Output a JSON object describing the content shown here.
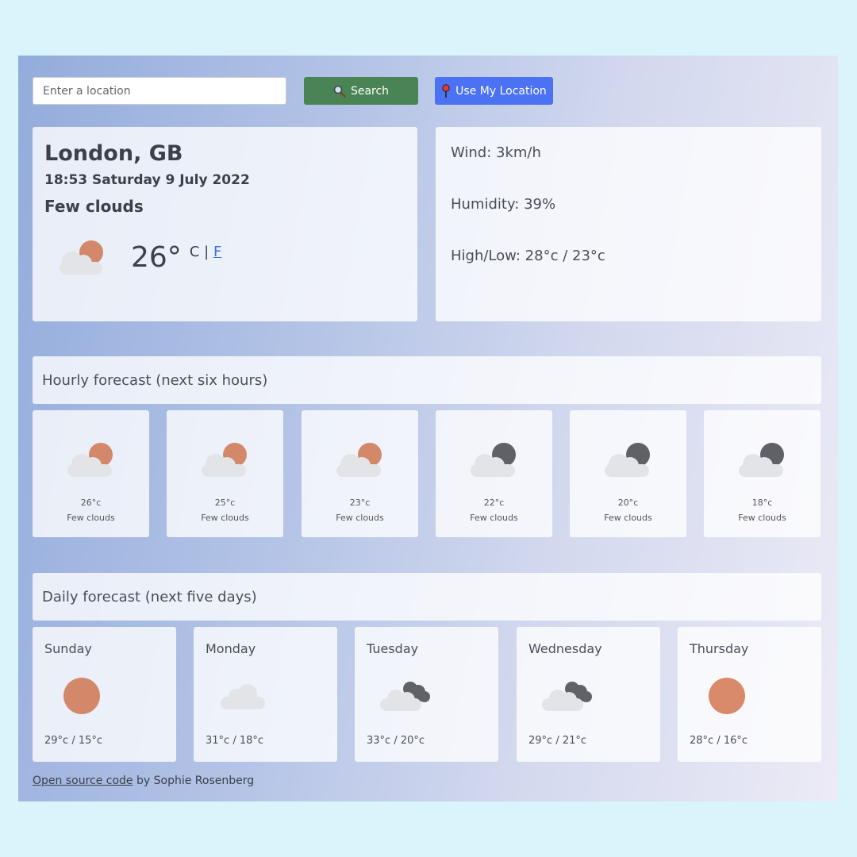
{
  "search": {
    "placeholder": "Enter a location",
    "value": ""
  },
  "buttons": {
    "search_label": "Search",
    "location_label": "Use My Location"
  },
  "current": {
    "city": "London, GB",
    "datetime": "18:53 Saturday 9 July 2022",
    "description": "Few clouds",
    "temp": "26°",
    "unit_c": "C",
    "unit_sep": "|",
    "unit_f": "F"
  },
  "details": {
    "wind": "Wind: 3km/h",
    "humidity": "Humidity: 39%",
    "highlow": "High/Low: 28°c / 23°c"
  },
  "hourly": {
    "heading": "Hourly forecast (next six hours)",
    "items": [
      {
        "temp": "26°c",
        "desc": "Few clouds",
        "icon": "few-clouds-day-icon"
      },
      {
        "temp": "25°c",
        "desc": "Few clouds",
        "icon": "few-clouds-day-icon"
      },
      {
        "temp": "23°c",
        "desc": "Few clouds",
        "icon": "few-clouds-day-icon"
      },
      {
        "temp": "22°c",
        "desc": "Few clouds",
        "icon": "few-clouds-night-icon"
      },
      {
        "temp": "20°c",
        "desc": "Few clouds",
        "icon": "few-clouds-night-icon"
      },
      {
        "temp": "18°c",
        "desc": "Few clouds",
        "icon": "few-clouds-night-icon"
      }
    ]
  },
  "daily": {
    "heading": "Daily forecast (next five days)",
    "items": [
      {
        "day": "Sunday",
        "temps": "29°c / 15°c",
        "icon": "sun-icon"
      },
      {
        "day": "Monday",
        "temps": "31°c / 18°c",
        "icon": "cloud-icon"
      },
      {
        "day": "Tuesday",
        "temps": "33°c / 20°c",
        "icon": "broken-clouds-icon"
      },
      {
        "day": "Wednesday",
        "temps": "29°c / 21°c",
        "icon": "broken-clouds-icon"
      },
      {
        "day": "Thursday",
        "temps": "28°c / 16°c",
        "icon": "sun-icon"
      }
    ]
  },
  "footer": {
    "link_text": "Open source code",
    "suffix": " by Sophie Rosenberg"
  },
  "colors": {
    "sun": "#d4886a",
    "moon": "#5f6166",
    "cloud_light": "#e3e4e7",
    "cloud_dark": "#606268",
    "search_btn": "#4a8455",
    "location_btn": "#4a72f2"
  }
}
